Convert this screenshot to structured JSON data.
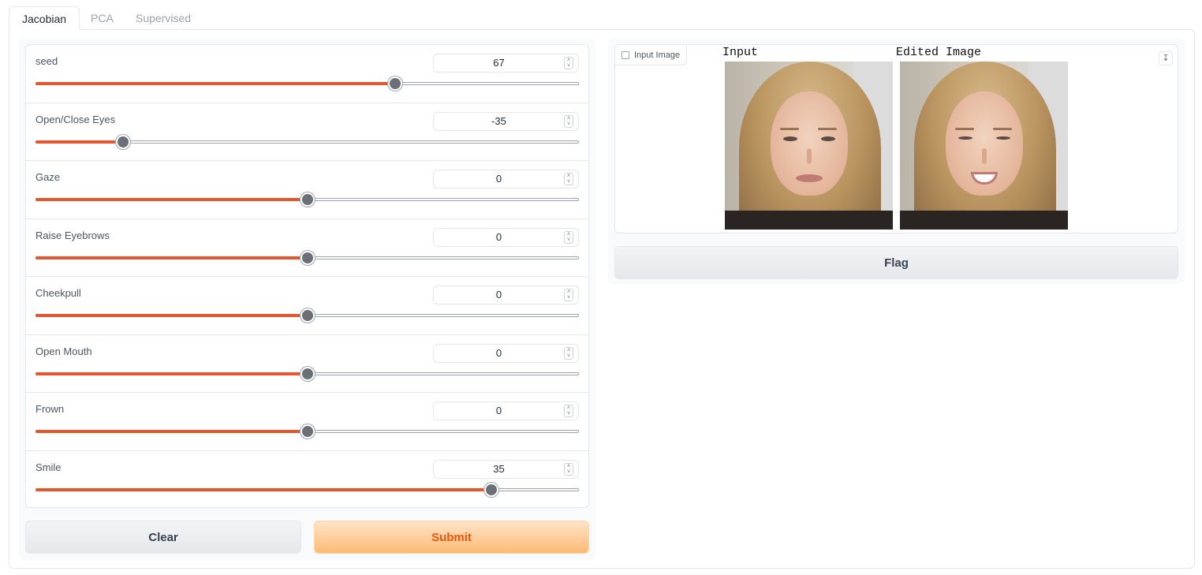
{
  "tabs": [
    {
      "label": "Jacobian",
      "active": true
    },
    {
      "label": "PCA",
      "active": false
    },
    {
      "label": "Supervised",
      "active": false
    }
  ],
  "sliders": [
    {
      "label": "seed",
      "value": "67",
      "fraction": 0.662
    },
    {
      "label": "Open/Close Eyes",
      "value": "-35",
      "fraction": 0.16
    },
    {
      "label": "Gaze",
      "value": "0",
      "fraction": 0.5
    },
    {
      "label": "Raise Eyebrows",
      "value": "0",
      "fraction": 0.5
    },
    {
      "label": "Cheekpull",
      "value": "0",
      "fraction": 0.5
    },
    {
      "label": "Open Mouth",
      "value": "0",
      "fraction": 0.5
    },
    {
      "label": "Frown",
      "value": "0",
      "fraction": 0.5
    },
    {
      "label": "Smile",
      "value": "35",
      "fraction": 0.84
    }
  ],
  "buttons": {
    "clear": "Clear",
    "submit": "Submit",
    "flag": "Flag"
  },
  "output": {
    "label": "Input Image",
    "caption_input": "Input",
    "caption_edited": "Edited Image"
  },
  "colors": {
    "accent": "#e4572e",
    "submit_text": "#ea580c"
  }
}
